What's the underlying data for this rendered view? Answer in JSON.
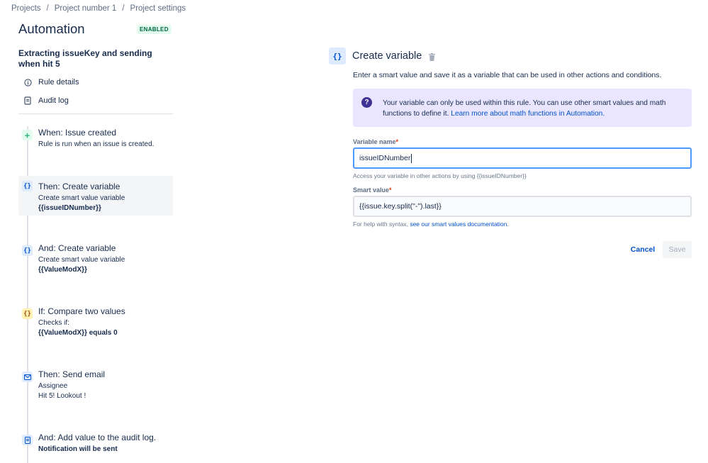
{
  "breadcrumbs": [
    "Projects",
    "Project number 1",
    "Project settings"
  ],
  "breadcrumb_separator": "/",
  "app": {
    "title": "Automation",
    "status_badge": "ENABLED"
  },
  "rule": {
    "name": "Extracting issueKey and sending when hit 5",
    "menu": [
      {
        "label": "Rule details",
        "icon": "info-icon"
      },
      {
        "label": "Audit log",
        "icon": "document-icon"
      }
    ]
  },
  "steps": [
    {
      "title": "When: Issue created",
      "icon": "plus-icon",
      "icon_glyph": "+",
      "lines": [
        "Rule is run when an issue is created."
      ],
      "bold_line": ""
    },
    {
      "title": "Then: Create variable",
      "icon": "braces-icon",
      "icon_glyph": "{}",
      "lines": [
        "Create smart value variable"
      ],
      "bold_line": "{{issueIDNumber}}"
    },
    {
      "title": "And: Create variable",
      "icon": "braces-icon",
      "icon_glyph": "{}",
      "lines": [
        "Create smart value variable"
      ],
      "bold_line": "{{ValueModX}}"
    },
    {
      "title": "If: Compare two values",
      "icon": "braces-icon",
      "icon_glyph": "{}",
      "lines": [
        "Checks if:"
      ],
      "bold_line": "{{ValueModX}} equals 0"
    },
    {
      "title": "Then: Send email",
      "icon": "email-icon",
      "icon_glyph": "",
      "lines": [
        "Assignee",
        "Hit 5! Lookout !"
      ],
      "bold_line": ""
    },
    {
      "title": "And: Add value to the audit log.",
      "icon": "document-icon",
      "icon_glyph": "",
      "lines": [],
      "bold_line": "Notification will be sent"
    }
  ],
  "panel": {
    "icon_glyph": "{}",
    "title": "Create variable",
    "description": "Enter a smart value and save it as a variable that can be used in other actions and conditions.",
    "info_text": "Your variable can only be used within this rule. You can use other smart values and math functions to define it. ",
    "info_link": "Learn more about math functions in Automation.",
    "variable_name_label": "Variable name",
    "required_marker": "*",
    "variable_name_value": "issueIDNumber",
    "variable_name_help": "Access your variable in other actions by using {{issueIDNumber}}",
    "smart_value_label": "Smart value",
    "smart_value_value": "{{issue.key.split(\"-\").last}}",
    "smart_value_help": "For help with syntax, ",
    "smart_value_help_link": "see our smart values documentation.",
    "cancel_label": "Cancel",
    "save_label": "Save"
  },
  "colors": {
    "accent": "#0052cc",
    "enabled_badge_bg": "#e3fcef",
    "enabled_badge_text": "#006644",
    "info_bg": "#eae6ff",
    "focus_border": "#4c9aff"
  }
}
